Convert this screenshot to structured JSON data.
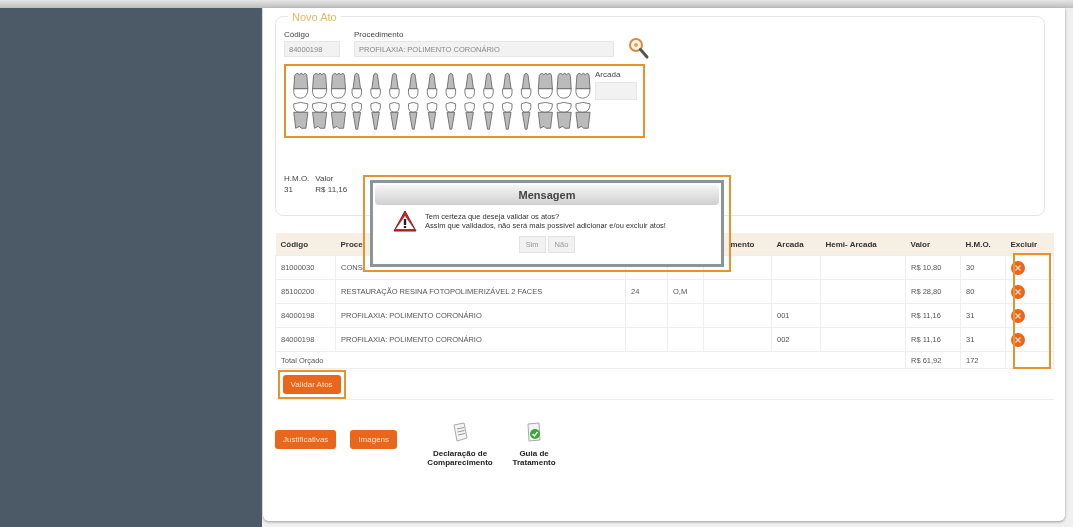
{
  "form": {
    "legend": "Novo Ato",
    "codigo_label": "Código",
    "codigo_value": "84000198",
    "procedimento_label": "Procedimento",
    "procedimento_value": "PROFILAXIA: POLIMENTO CORONÁRIO",
    "arcada_label": "Arcada",
    "hmo_label": "H.M.O.",
    "hmo_value": "31",
    "valor_label": "Valor",
    "valor_value": "R$ 11,16"
  },
  "dialog": {
    "title": "Mensagem",
    "message": [
      "Tem certeza que deseja validar os atos?",
      "Assim que validados, não será mais possível adicionar e/ou excluir atos!"
    ],
    "buttons": [
      "Sim",
      "Não"
    ]
  },
  "table": {
    "columns": [
      "Código",
      "Proce",
      null,
      null,
      "mento",
      "Arcada",
      "Hemi- Arcada",
      "Valor",
      "H.M.O.",
      "Excluir"
    ],
    "rows": [
      {
        "cells": [
          "81000030",
          "CONS",
          null,
          null,
          null,
          null,
          null,
          "R$ 10,80",
          "30"
        ],
        "removable": true
      },
      {
        "cells": [
          "85100200",
          "RESTAURAÇÃO RESINA FOTOPOLIMERIZÁVEL 2 FACES",
          "24",
          "O,M",
          null,
          null,
          null,
          "R$ 28,80",
          "80"
        ],
        "removable": true
      },
      {
        "cells": [
          "84000198",
          "PROFILAXIA: POLIMENTO CORONÁRIO",
          null,
          null,
          null,
          "001",
          null,
          "R$ 11,16",
          "31"
        ],
        "removable": true
      },
      {
        "cells": [
          "84000198",
          "PROFILAXIA: POLIMENTO CORONÁRIO",
          null,
          null,
          null,
          "002",
          null,
          "R$ 11,16",
          "31"
        ],
        "removable": true
      }
    ],
    "total": {
      "label": "Total Orçado",
      "valor": "R$ 61,92",
      "hmo": "172"
    }
  },
  "validate_button": "Validar Atos",
  "buttons": [
    "Justificativas",
    "Imagens"
  ],
  "documents": [
    {
      "kind": "declaration",
      "label": "Declaração de Comparecimento"
    },
    {
      "kind": "guide",
      "label": "Guia de Tratamento"
    }
  ]
}
